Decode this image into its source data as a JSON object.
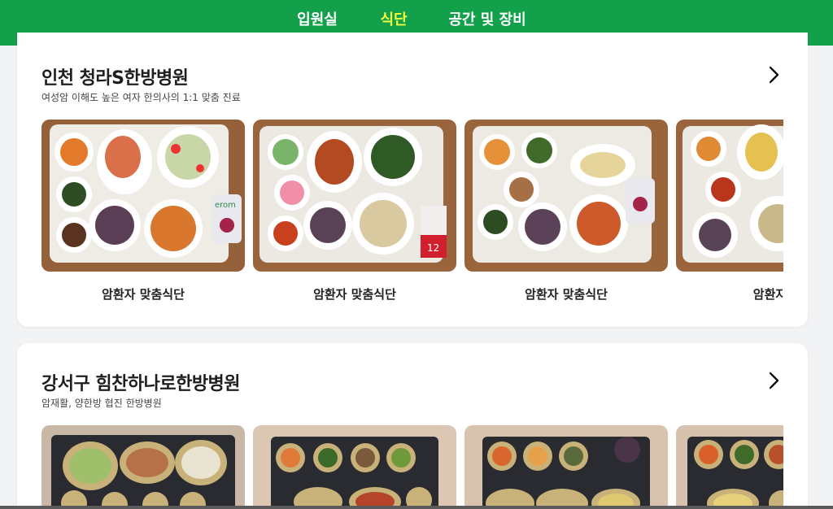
{
  "nav": {
    "tabs": [
      {
        "label": "입원실",
        "active": false
      },
      {
        "label": "식단",
        "active": true
      },
      {
        "label": "공간 및 장비",
        "active": false
      }
    ],
    "active_color": "#f4ff3e",
    "background": "#12a04a"
  },
  "hospitals": [
    {
      "name": "인천 청라S한방병원",
      "subtitle": "여성암 이해도 높은 여자 한의사의 1:1 맞춤 진료",
      "meals": [
        {
          "caption": "암환자 맞춤식단",
          "image": "meal-tray-photo"
        },
        {
          "caption": "암환자 맞춤식단",
          "image": "meal-tray-photo"
        },
        {
          "caption": "암환자 맞춤식단",
          "image": "meal-tray-photo"
        },
        {
          "caption": "암환자 및",
          "image": "meal-tray-photo"
        }
      ]
    },
    {
      "name": "강서구 힘찬하나로한방병원",
      "subtitle": "암재활, 양한방 협진 한방병원",
      "meals": [
        {
          "caption": "",
          "image": "meal-tray-photo"
        },
        {
          "caption": "",
          "image": "meal-tray-photo"
        },
        {
          "caption": "",
          "image": "meal-tray-photo"
        },
        {
          "caption": "",
          "image": "meal-tray-photo"
        }
      ]
    }
  ],
  "package_labels": [
    "erom",
    "12"
  ]
}
